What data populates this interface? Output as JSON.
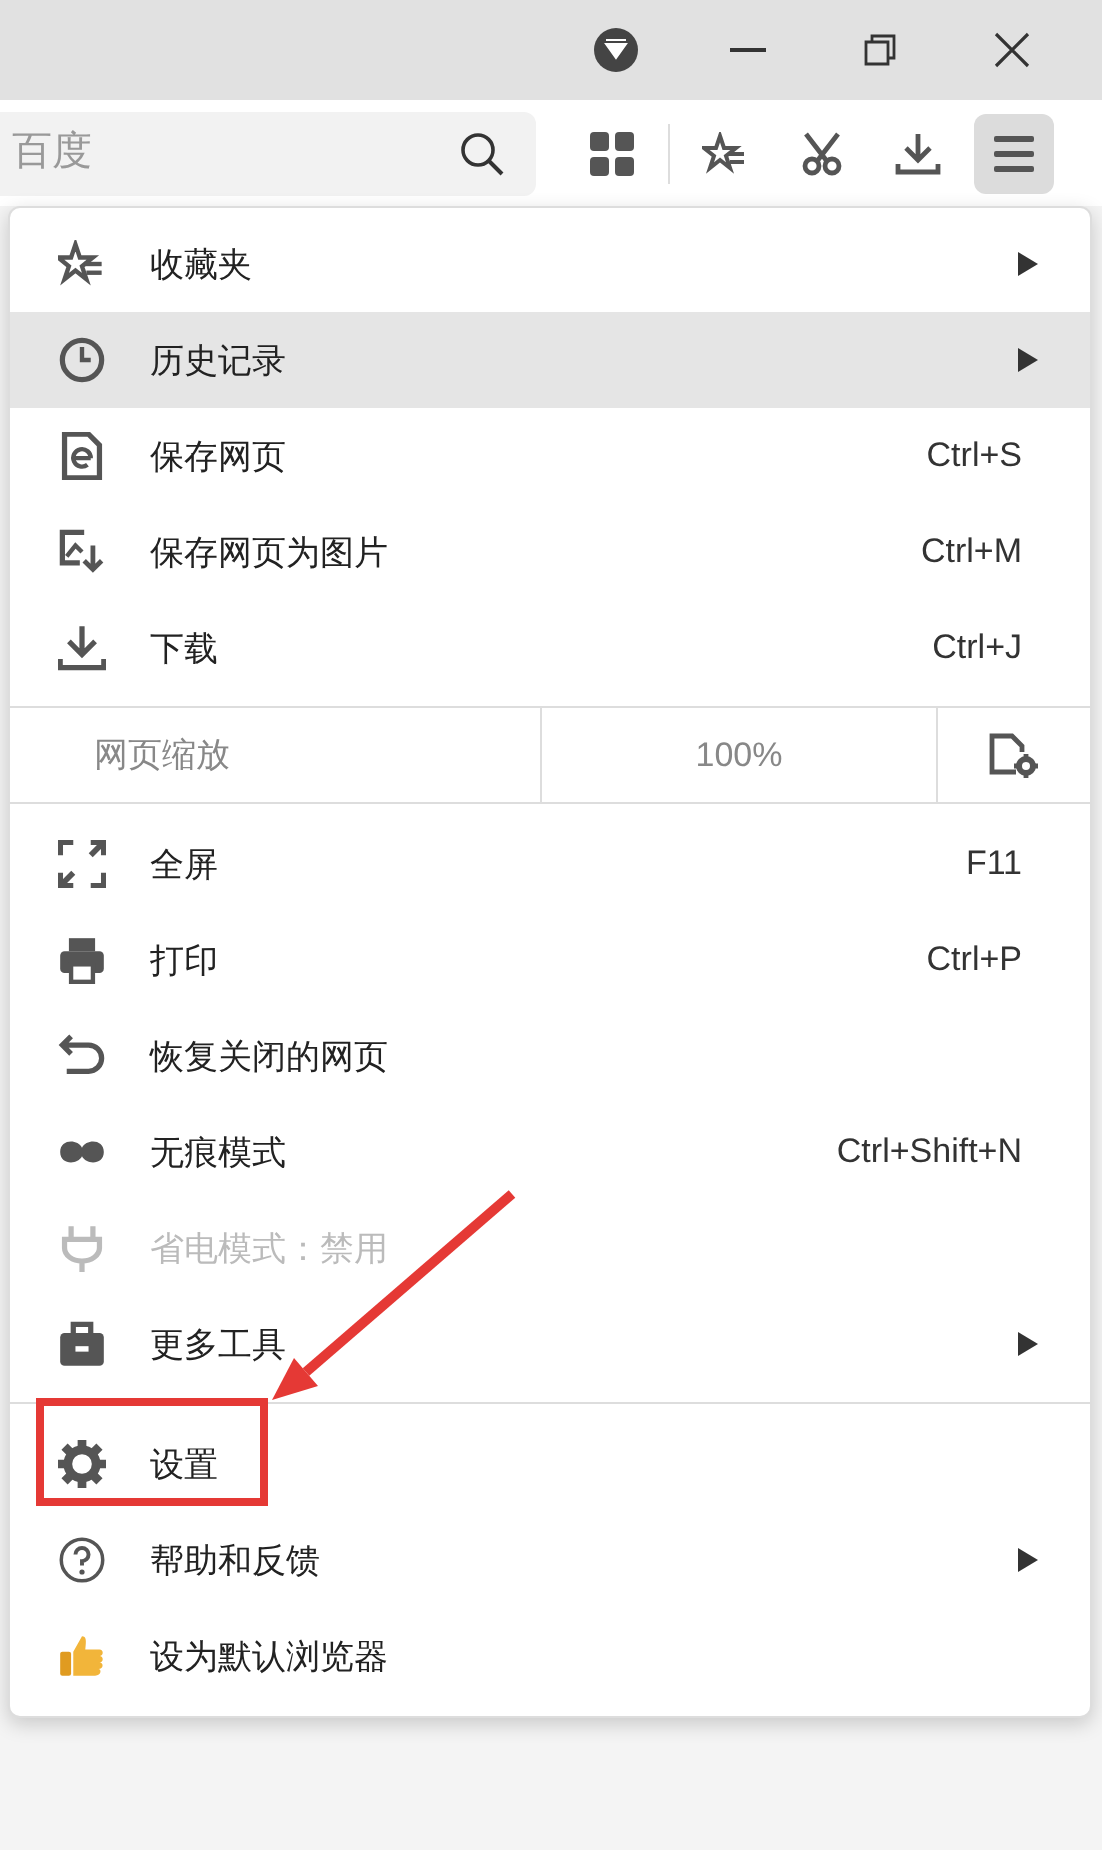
{
  "toolbar": {
    "search": {
      "placeholder": "百度"
    },
    "menu_button": {
      "pressed": true
    }
  },
  "menu": {
    "items": [
      {
        "kind": "item",
        "label": "收藏夹",
        "submenu": true,
        "selected": false,
        "disabled": false,
        "outlined": false
      },
      {
        "kind": "item",
        "label": "历史记录",
        "submenu": true,
        "selected": true,
        "disabled": false,
        "outlined": false
      },
      {
        "kind": "item",
        "label": "保存网页",
        "shortcut": "Ctrl+S",
        "submenu": false,
        "selected": false,
        "disabled": false,
        "outlined": false
      },
      {
        "kind": "item",
        "label": "保存网页为图片",
        "shortcut": "Ctrl+M",
        "submenu": false,
        "selected": false,
        "disabled": false,
        "outlined": false
      },
      {
        "kind": "item",
        "label": "下载",
        "shortcut": "Ctrl+J",
        "submenu": false,
        "selected": false,
        "disabled": false,
        "outlined": false
      },
      {
        "kind": "separator"
      },
      {
        "kind": "zoom",
        "label": "网页缩放",
        "value": "100%"
      },
      {
        "kind": "separator"
      },
      {
        "kind": "item",
        "label": "全屏",
        "shortcut": "F11",
        "submenu": false,
        "selected": false,
        "disabled": false,
        "outlined": false
      },
      {
        "kind": "item",
        "label": "打印",
        "shortcut": "Ctrl+P",
        "submenu": false,
        "selected": false,
        "disabled": false,
        "outlined": false
      },
      {
        "kind": "item",
        "label": "恢复关闭的网页",
        "submenu": false,
        "selected": false,
        "disabled": false,
        "outlined": false
      },
      {
        "kind": "item",
        "label": "无痕模式",
        "shortcut": "Ctrl+Shift+N",
        "submenu": false,
        "selected": false,
        "disabled": false,
        "outlined": false
      },
      {
        "kind": "item",
        "label": "省电模式：禁用",
        "submenu": false,
        "selected": false,
        "disabled": true,
        "outlined": false
      },
      {
        "kind": "item",
        "label": "更多工具",
        "submenu": true,
        "selected": false,
        "disabled": false,
        "outlined": false
      },
      {
        "kind": "separator"
      },
      {
        "kind": "item",
        "label": "设置",
        "submenu": false,
        "selected": false,
        "disabled": false,
        "outlined": true
      },
      {
        "kind": "item",
        "label": "帮助和反馈",
        "submenu": true,
        "selected": false,
        "disabled": false,
        "outlined": false
      },
      {
        "kind": "item",
        "label": "设为默认浏览器",
        "submenu": false,
        "selected": false,
        "disabled": false,
        "outlined": false
      }
    ]
  }
}
